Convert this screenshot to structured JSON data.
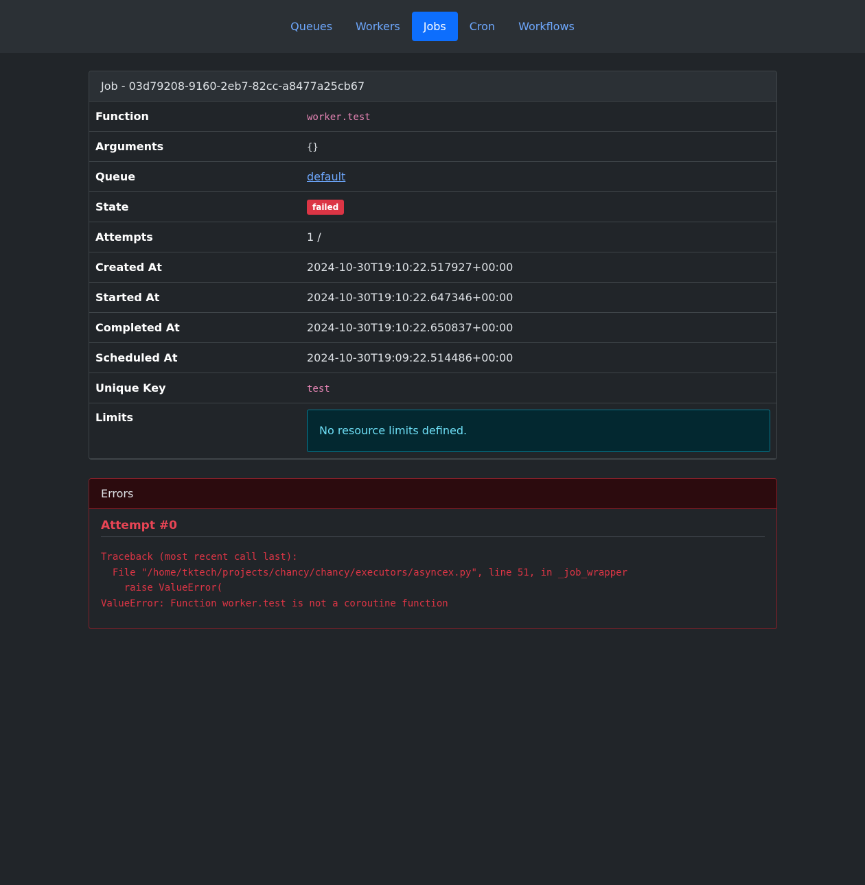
{
  "nav": {
    "items": [
      {
        "label": "Queues",
        "active": false
      },
      {
        "label": "Workers",
        "active": false
      },
      {
        "label": "Jobs",
        "active": true
      },
      {
        "label": "Cron",
        "active": false
      },
      {
        "label": "Workflows",
        "active": false
      }
    ]
  },
  "job": {
    "header": "Job - 03d79208-9160-2eb7-82cc-a8477a25cb67",
    "rows": {
      "function": {
        "label": "Function",
        "value": "worker.test"
      },
      "arguments": {
        "label": "Arguments",
        "value": "{}"
      },
      "queue": {
        "label": "Queue",
        "value": "default"
      },
      "state": {
        "label": "State",
        "value": "failed"
      },
      "attempts": {
        "label": "Attempts",
        "value": "1 /"
      },
      "created_at": {
        "label": "Created At",
        "value": "2024-10-30T19:10:22.517927+00:00"
      },
      "started_at": {
        "label": "Started At",
        "value": "2024-10-30T19:10:22.647346+00:00"
      },
      "completed_at": {
        "label": "Completed At",
        "value": "2024-10-30T19:10:22.650837+00:00"
      },
      "scheduled_at": {
        "label": "Scheduled At",
        "value": "2024-10-30T19:09:22.514486+00:00"
      },
      "unique_key": {
        "label": "Unique Key",
        "value": "test"
      },
      "limits": {
        "label": "Limits",
        "value": "No resource limits defined."
      }
    }
  },
  "errors": {
    "header": "Errors",
    "attempts": [
      {
        "title": "Attempt #0",
        "traceback": "Traceback (most recent call last):\n  File \"/home/tktech/projects/chancy/chancy/executors/asyncex.py\", line 51, in _job_wrapper\n    raise ValueError(\nValueError: Function worker.test is not a coroutine function"
      }
    ]
  },
  "colors": {
    "background": "#212529",
    "nav_background": "#2b3035",
    "link": "#6ea8fe",
    "active": "#0d6efd",
    "danger": "#dc3545",
    "info": "#6edff6"
  }
}
